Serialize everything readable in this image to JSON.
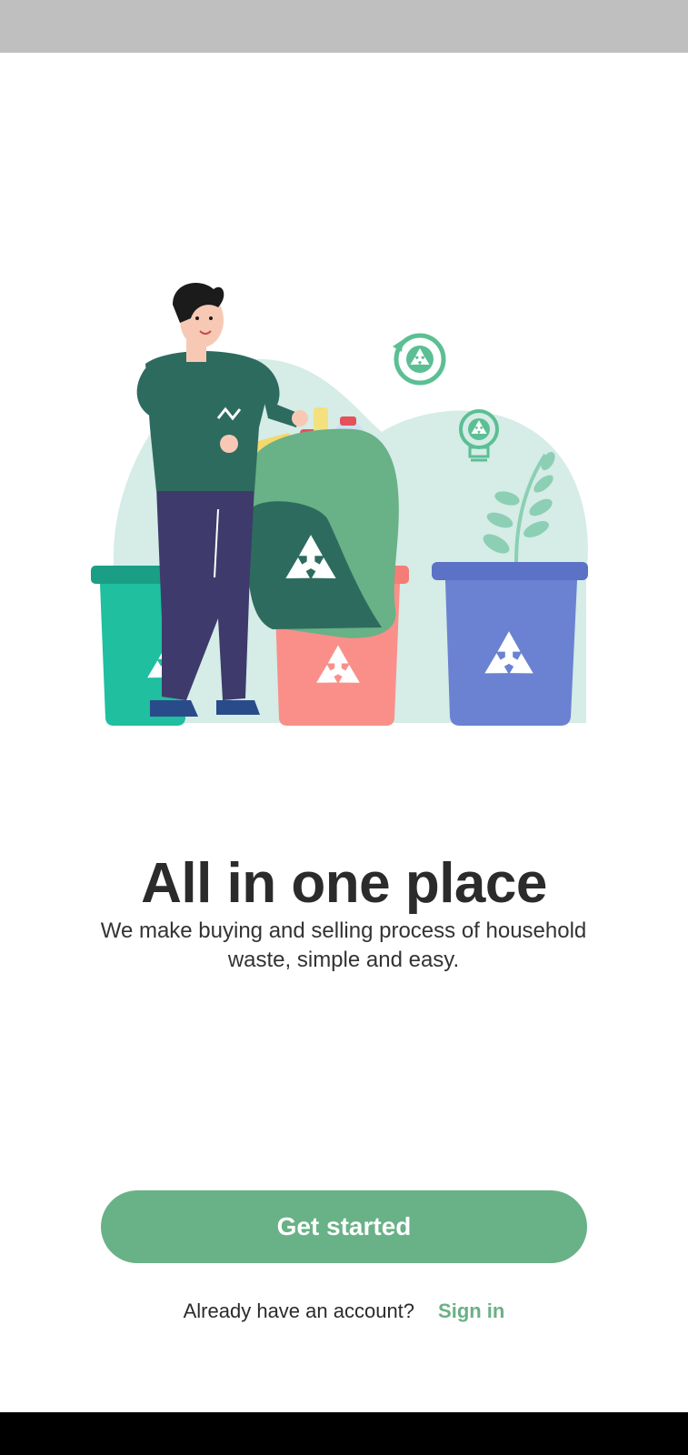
{
  "onboarding": {
    "title": "All in one place",
    "subtitle": "We make buying and selling process of household waste, simple and easy.",
    "primary_button_label": "Get started",
    "signin_prompt": "Already have an account?",
    "signin_link_label": "Sign in"
  },
  "illustration": {
    "icons": [
      "recycle-refresh-icon",
      "recycle-bulb-icon",
      "recycle-icon"
    ],
    "colors": {
      "bin_left": "#1fbf9f",
      "bin_middle": "#fa8f8a",
      "bin_right": "#6a82d1",
      "bag": "#69b186",
      "background_blob": "#d5ece7"
    }
  },
  "theme": {
    "accent": "#69b186",
    "text_dark": "#2b2b2b"
  }
}
